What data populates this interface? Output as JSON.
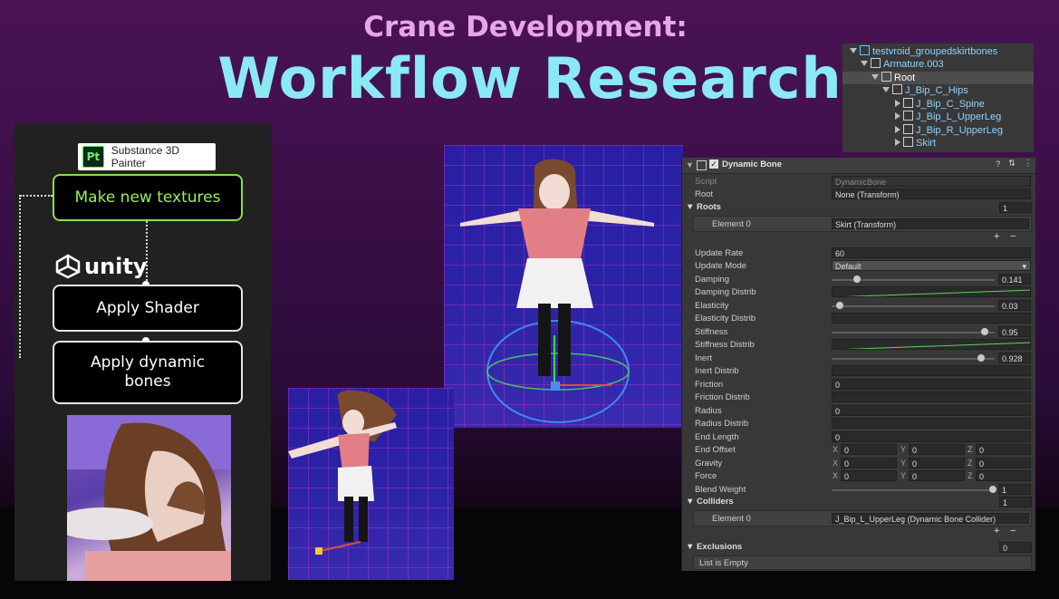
{
  "title": {
    "line1": "Crane Development:",
    "line2": "Workflow Research"
  },
  "flow": {
    "substance_label": "Substance 3D Painter",
    "substance_logo_text": "Pt",
    "step1": "Make new textures",
    "unity_label": "unity",
    "step2": "Apply Shader",
    "step3_line1": "Apply dynamic",
    "step3_line2": "bones"
  },
  "hierarchy": {
    "items": [
      {
        "label": "testvroid_groupedskirtbones",
        "depth": 0,
        "expanded": true
      },
      {
        "label": "Armature.003",
        "depth": 1,
        "expanded": true
      },
      {
        "label": "Root",
        "depth": 2,
        "expanded": true,
        "selected": true
      },
      {
        "label": "J_Bip_C_Hips",
        "depth": 3,
        "expanded": true
      },
      {
        "label": "J_Bip_C_Spine",
        "depth": 4,
        "expanded": false
      },
      {
        "label": "J_Bip_L_UpperLeg",
        "depth": 4,
        "expanded": false
      },
      {
        "label": "J_Bip_R_UpperLeg",
        "depth": 4,
        "expanded": false
      },
      {
        "label": "Skirt",
        "depth": 4,
        "expanded": false
      }
    ]
  },
  "inspector": {
    "component_title": "Dynamic Bone",
    "script_label": "Script",
    "script_value": "DynamicBone",
    "root_label": "Root",
    "root_value": "None (Transform)",
    "roots_label": "Roots",
    "roots_count": "1",
    "roots_element_label": "Element 0",
    "roots_element_value": "Skirt (Transform)",
    "update_rate_label": "Update Rate",
    "update_rate_value": "60",
    "update_mode_label": "Update Mode",
    "update_mode_value": "Default",
    "damping_label": "Damping",
    "damping_value": "0.141",
    "damping_distrib_label": "Damping Distrib",
    "elasticity_label": "Elasticity",
    "elasticity_value": "0.03",
    "elasticity_distrib_label": "Elasticity Distrib",
    "stiffness_label": "Stiffness",
    "stiffness_value": "0.95",
    "stiffness_distrib_label": "Stiffness Distrib",
    "inert_label": "Inert",
    "inert_value": "0.928",
    "inert_distrib_label": "Inert Distrib",
    "friction_label": "Friction",
    "friction_value": "0",
    "friction_distrib_label": "Friction Distrib",
    "radius_label": "Radius",
    "radius_value": "0",
    "radius_distrib_label": "Radius Distrib",
    "end_length_label": "End Length",
    "end_length_value": "0",
    "end_offset_label": "End Offset",
    "gravity_label": "Gravity",
    "force_label": "Force",
    "axis_x": "X",
    "axis_y": "Y",
    "axis_z": "Z",
    "vec_zero": "0",
    "blend_weight_label": "Blend Weight",
    "blend_weight_value": "1",
    "colliders_label": "Colliders",
    "colliders_count": "1",
    "colliders_element_label": "Element 0",
    "colliders_element_value": "J_Bip_L_UpperLeg (Dynamic Bone Collider)",
    "exclusions_label": "Exclusions",
    "exclusions_count": "0",
    "exclusions_empty": "List is Empty",
    "plus": "+",
    "minus": "−"
  }
}
